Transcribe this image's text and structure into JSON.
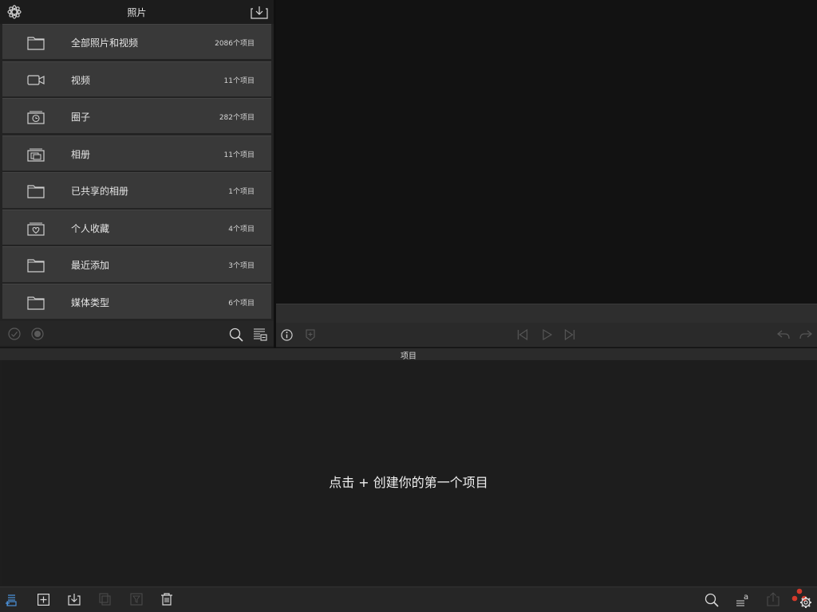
{
  "library": {
    "title": "照片",
    "albums": [
      {
        "name": "全部照片和视频",
        "count": "2086个项目",
        "icon": "folder-icon"
      },
      {
        "name": "视频",
        "count": "11个项目",
        "icon": "video-camera-icon"
      },
      {
        "name": "圈子",
        "count": "282个项目",
        "icon": "clock-album-icon"
      },
      {
        "name": "相册",
        "count": "11个项目",
        "icon": "photo-album-icon"
      },
      {
        "name": "已共享的相册",
        "count": "1个项目",
        "icon": "folder-icon"
      },
      {
        "name": "个人收藏",
        "count": "4个项目",
        "icon": "heart-album-icon"
      },
      {
        "name": "最近添加",
        "count": "3个项目",
        "icon": "folder-icon"
      },
      {
        "name": "媒体类型",
        "count": "6个项目",
        "icon": "folder-icon"
      }
    ]
  },
  "projects": {
    "title": "项目",
    "empty_message": "点击 + 创建你的第一个项目"
  },
  "colors": {
    "background": "#1e1e1e",
    "row": "#393939",
    "text": "#e4e4e4",
    "accent_blue": "#4a8fd6",
    "accent_red": "#d33a2c"
  }
}
